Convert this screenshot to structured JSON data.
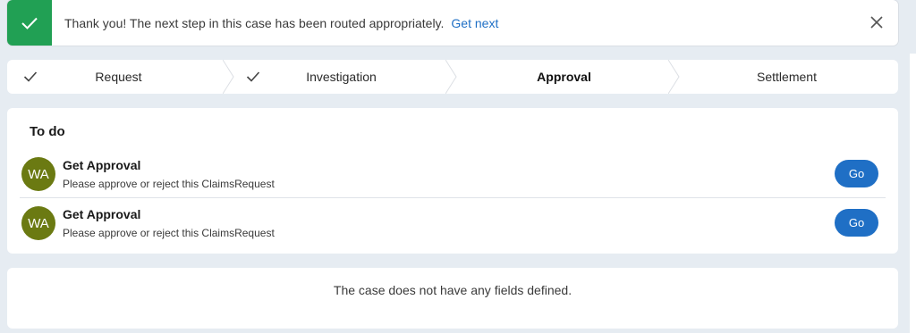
{
  "banner": {
    "message": "Thank you! The next step in this case has been routed appropriately.",
    "link_label": "Get next",
    "accent": "#21a054"
  },
  "stepper": {
    "steps": [
      {
        "label": "Request",
        "completed": true,
        "current": false
      },
      {
        "label": "Investigation",
        "completed": true,
        "current": false
      },
      {
        "label": "Approval",
        "completed": false,
        "current": true
      },
      {
        "label": "Settlement",
        "completed": false,
        "current": false
      }
    ]
  },
  "todo": {
    "title": "To do",
    "items": [
      {
        "avatar": "WA",
        "title": "Get Approval",
        "description": "Please approve or reject this ClaimsRequest",
        "button": "Go"
      },
      {
        "avatar": "WA",
        "title": "Get Approval",
        "description": "Please approve or reject this ClaimsRequest",
        "button": "Go"
      }
    ]
  },
  "fields": {
    "message": "The case does not have any fields defined."
  },
  "colors": {
    "primary": "#1f6fc5",
    "avatar": "#6b7a12",
    "background": "#e6ecf2"
  }
}
